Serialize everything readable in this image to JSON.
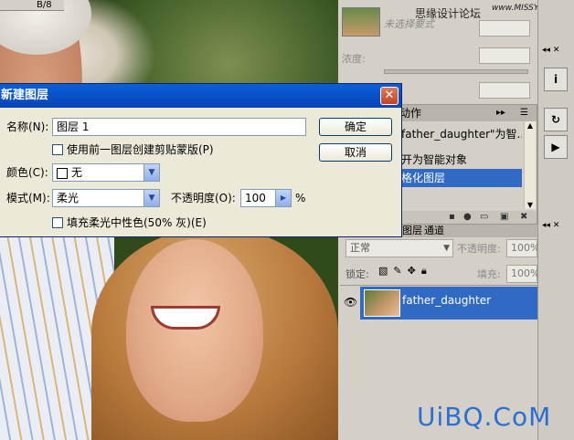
{
  "watermark_top": "思缘设计论坛",
  "watermark_top_url": "www.MISSYUAN.COM",
  "watermark_bottom": "UiBQ.CoM",
  "tab_fragment": "B/8",
  "style_panel": {
    "no_style_text": "未选择要式",
    "opacity_label": "浓度:"
  },
  "actions_panel": {
    "tab_label": "动作",
    "items": [
      {
        "label": "father_daughter\"为智...",
        "selected": false
      },
      {
        "label": "开为智能对象",
        "selected": false
      },
      {
        "label": "格化图层",
        "selected": true
      }
    ]
  },
  "layers_panel": {
    "tab_labels": [
      "图层",
      "通道"
    ],
    "blend_mode": "正常",
    "opacity_label": "不透明度:",
    "opacity_value": "100%",
    "lock_label": "锁定:",
    "fill_label": "填充:",
    "fill_value": "100%",
    "layer_name": "father_daughter"
  },
  "dialog": {
    "title": "新建图层",
    "name_label": "名称(N):",
    "name_value": "图层 1",
    "clip_checkbox_label": "使用前一图层创建剪贴蒙版(P)",
    "color_label": "颜色(C):",
    "color_value": "无",
    "mode_label": "模式(M):",
    "mode_value": "柔光",
    "opacity_label": "不透明度(O):",
    "opacity_value": "100",
    "opacity_unit": "%",
    "fill_checkbox_label": "填充柔光中性色(50% 灰)(E)",
    "ok_label": "确定",
    "cancel_label": "取消",
    "close_glyph": "✕"
  },
  "colors": {
    "dialog_title": "#0a5fd8",
    "selection": "#316ac5",
    "watermark": "#2a6fd6"
  }
}
